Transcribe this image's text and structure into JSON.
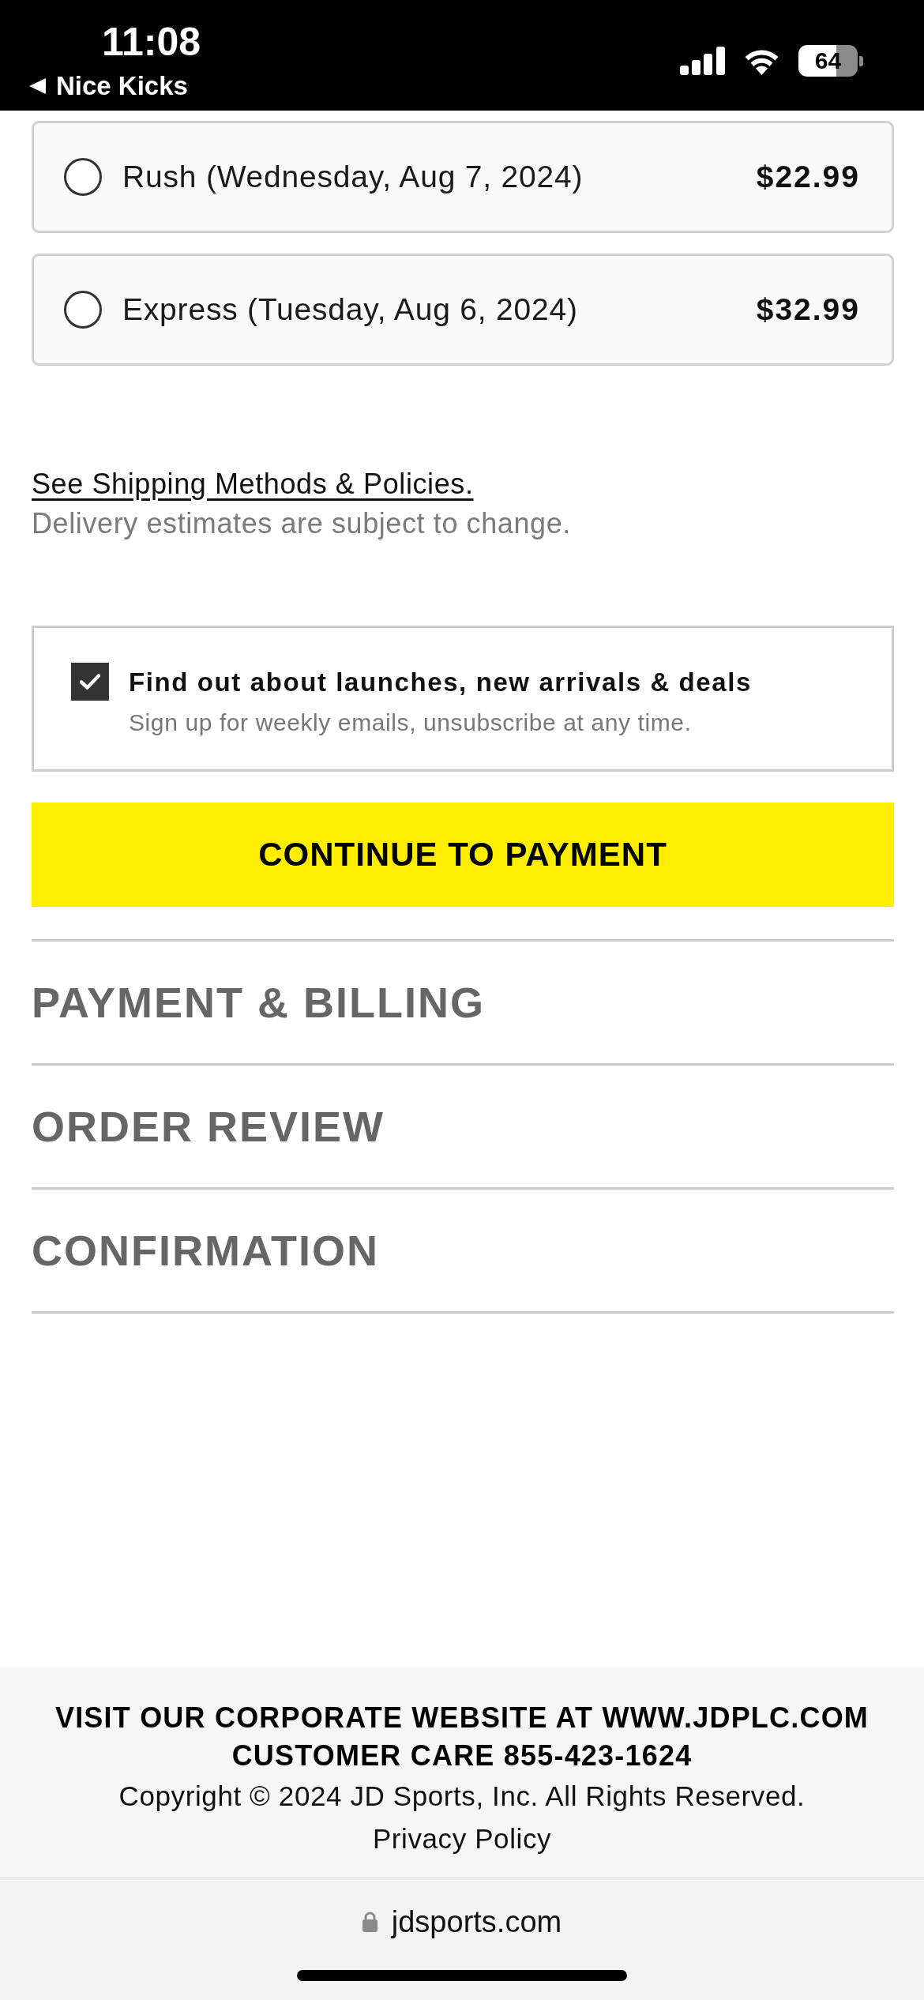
{
  "status_bar": {
    "time": "11:08",
    "back_label": "Nice Kicks",
    "battery": "64"
  },
  "shipping_options": [
    {
      "label": "Rush (Wednesday, Aug 7, 2024)",
      "price": "$22.99",
      "selected": false
    },
    {
      "label": "Express (Tuesday, Aug 6, 2024)",
      "price": "$32.99",
      "selected": false
    }
  ],
  "shipping_link": "See Shipping Methods & Policies.",
  "delivery_note": "Delivery estimates are subject to change.",
  "newsletter": {
    "title": "Find out about launches, new arrivals & deals",
    "subtitle": "Sign up for weekly emails, unsubscribe at any time.",
    "checked": true
  },
  "continue_button": "CONTINUE TO PAYMENT",
  "sections": [
    {
      "title": "PAYMENT & BILLING"
    },
    {
      "title": "ORDER REVIEW"
    },
    {
      "title": "CONFIRMATION"
    }
  ],
  "footer": {
    "lines": [
      {
        "kind": "heading",
        "text": "VISIT OUR CORPORATE WEBSITE AT WWW.JDPLC.COM"
      },
      {
        "kind": "heading",
        "text": "CUSTOMER CARE 855-423-1624"
      },
      {
        "kind": "text",
        "text": "Copyright © 2024 JD Sports, Inc. All Rights Reserved."
      },
      {
        "kind": "link",
        "text": "Privacy Policy"
      }
    ]
  },
  "browser_bar": {
    "url": "jdsports.com"
  }
}
